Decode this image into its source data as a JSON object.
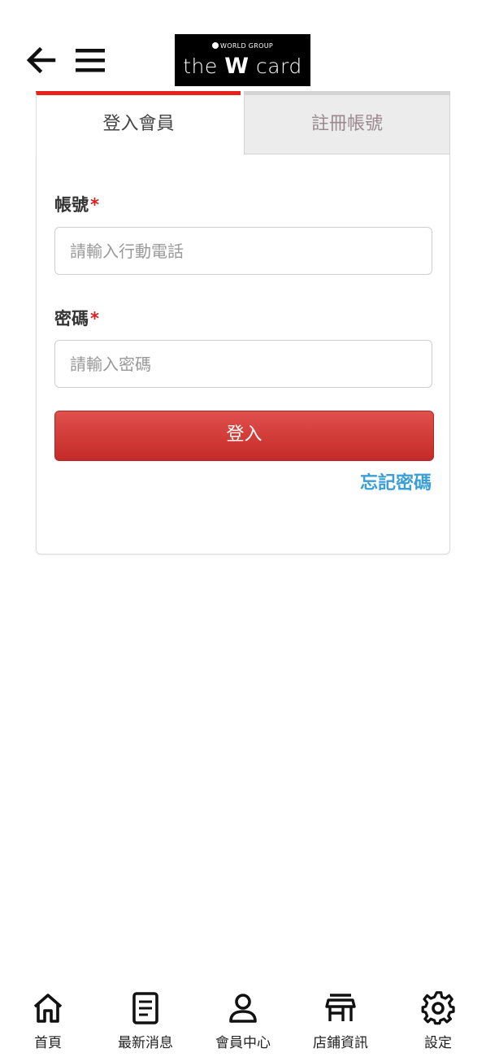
{
  "header": {
    "logo_group": "WORLD GROUP",
    "logo_pre": "the",
    "logo_w": "W",
    "logo_post": "card"
  },
  "tabs": {
    "login": "登入會員",
    "register": "註冊帳號"
  },
  "form": {
    "account_label": "帳號",
    "account_required": "*",
    "account_placeholder": "請輸入行動電話",
    "password_label": "密碼",
    "password_required": "*",
    "password_placeholder": "請輸入密碼",
    "login_button": "登入",
    "forgot_link": "忘記密碼"
  },
  "bottom_nav": [
    {
      "label": "首頁",
      "icon": "home-icon"
    },
    {
      "label": "最新消息",
      "icon": "news-icon"
    },
    {
      "label": "會員中心",
      "icon": "user-icon"
    },
    {
      "label": "店鋪資訊",
      "icon": "store-icon"
    },
    {
      "label": "設定",
      "icon": "gear-icon"
    }
  ],
  "colors": {
    "accent_red": "#e8201c",
    "button_red": "#c42a28",
    "link_blue": "#3a9fd6"
  }
}
